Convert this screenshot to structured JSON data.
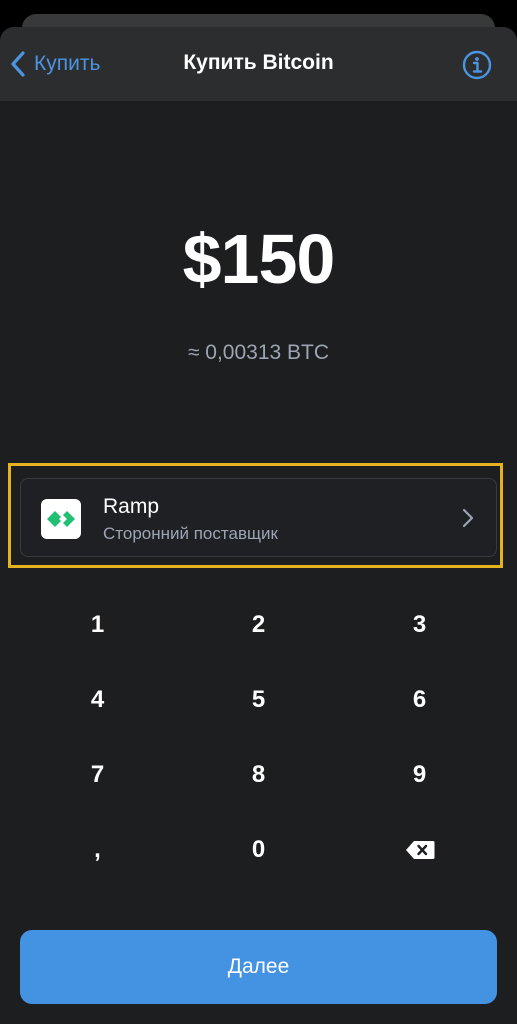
{
  "navbar": {
    "back_label": "Купить",
    "title": "Купить Bitcoin",
    "back_icon": "chevron-left-icon",
    "info_icon": "info-circle-icon"
  },
  "amount": {
    "fiat": "$150",
    "crypto": "≈ 0,00313 BTC"
  },
  "provider": {
    "name": "Ramp",
    "subtitle": "Сторонний поставщик",
    "logo_icon": "ramp-logo-icon",
    "chevron_icon": "chevron-right-icon"
  },
  "keypad": {
    "keys": [
      "1",
      "2",
      "3",
      "4",
      "5",
      "6",
      "7",
      "8",
      "9",
      ",",
      "0"
    ],
    "backspace_icon": "backspace-icon"
  },
  "continue_label": "Далее",
  "colors": {
    "accent": "#4492e2",
    "highlight": "#e5b222",
    "secondary_text": "#9da4b3",
    "background": "#1d1e20",
    "ramp_green": "#21bf73"
  }
}
